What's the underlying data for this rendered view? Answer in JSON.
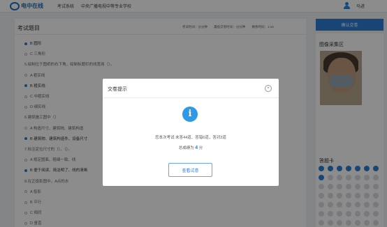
{
  "header": {
    "logo_text": "电中在线",
    "nav_label": "考试系统",
    "school": "中央广播电视中等专业学校",
    "username": "马进"
  },
  "exam": {
    "title": "考试题目",
    "meta": [
      "考试时间：分分钟",
      "最低交卷时间：分分钟",
      "剩余时间：1:16"
    ],
    "questions": [
      {
        "text": "B 圆形",
        "type": "option",
        "selected": true
      },
      {
        "text": "C 三角形",
        "type": "option",
        "selected": false
      },
      {
        "text": "5.绘制位于图纸的右下角，绘制标题栏的线宽用（）。",
        "type": "stem"
      },
      {
        "text": "A 粗实线",
        "type": "option",
        "selected": false
      },
      {
        "text": "B 粗实线",
        "type": "option",
        "selected": true
      },
      {
        "text": "C 中粗实线",
        "type": "option",
        "selected": false
      },
      {
        "text": "D 细实线",
        "type": "option",
        "selected": false
      },
      {
        "text": "6.建筑施工图中（）",
        "type": "stem"
      },
      {
        "text": "A 构造尺寸、建筑物、建筑构造",
        "type": "option",
        "selected": false
      },
      {
        "text": "B 建筑物、建筑构造件、设备尺寸",
        "type": "option",
        "selected": true
      },
      {
        "text": "7.标注定位尺寸的（）、（）。",
        "type": "stem"
      },
      {
        "text": "A 规定图面、粗细一致、线",
        "type": "option",
        "selected": false
      },
      {
        "text": "B 便于阅读、简洁明了、线的清晰",
        "type": "option",
        "selected": true
      },
      {
        "text": "8.在正投影图中，A点的水",
        "type": "stem"
      },
      {
        "text": "A 投影",
        "type": "option",
        "selected": false
      },
      {
        "text": "B 平行",
        "type": "option",
        "selected": false
      },
      {
        "text": "C 相同",
        "type": "option",
        "selected": false
      },
      {
        "text": "D 垂直",
        "type": "option",
        "selected": false
      }
    ]
  },
  "sidebar": {
    "submit_label": "确认交卷",
    "photo_title": "图像采集区",
    "card_title": "答题卡"
  },
  "modal": {
    "title": "交卷提示",
    "close_icon": "×",
    "info_icon": "i",
    "summary": "您本次考试 未答44道、答错6道，答对2道",
    "score_prefix": "总成绩为",
    "score": "4",
    "score_suffix": "分",
    "view_button": "查看试卷"
  }
}
